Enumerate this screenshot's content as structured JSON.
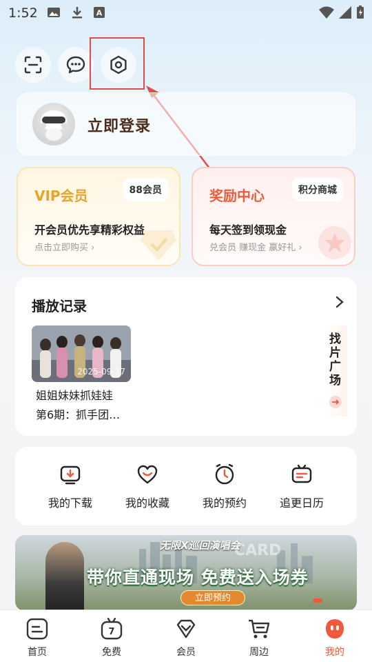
{
  "status_bar": {
    "time": "1:52"
  },
  "login": {
    "label": "立即登录"
  },
  "vip_card": {
    "title": "VIP会员",
    "badge": "88会员",
    "subtitle": "开会员优先享精彩权益",
    "link": "点击立即购买 ›"
  },
  "reward_card": {
    "title": "奖励中心",
    "badge": "积分商城",
    "subtitle": "每天签到领现金",
    "link": "兑会员 赚现金 赢好礼 ›"
  },
  "history": {
    "title": "播放记录",
    "item": {
      "date": "2025-09-17",
      "title": "姐姐妹妹抓娃娃",
      "episode": "第6期：抓手团…"
    },
    "find_label": "找片广场"
  },
  "quick_actions": [
    {
      "label": "我的下载",
      "icon": "download-icon"
    },
    {
      "label": "我的收藏",
      "icon": "favorite-icon"
    },
    {
      "label": "我的预约",
      "icon": "clock-icon"
    },
    {
      "label": "追更日历",
      "icon": "calendar-tv-icon"
    }
  ],
  "banner": {
    "headline": "带你直通现场 免费送入场券",
    "cta": "立即预约",
    "event_title": "无限X巡回演唱会",
    "brand": "CARD"
  },
  "bottom_nav": [
    {
      "label": "首页",
      "icon": "home-icon"
    },
    {
      "label": "免费",
      "icon": "free-tv-icon"
    },
    {
      "label": "会员",
      "icon": "vip-diamond-icon"
    },
    {
      "label": "周边",
      "icon": "shopping-cart-icon"
    },
    {
      "label": "我的",
      "icon": "profile-face-icon",
      "active": true
    }
  ],
  "colors": {
    "accent_red": "#ef5a3a",
    "vip_gold": "#e8a42a",
    "annotation_red": "#e24a4a"
  }
}
